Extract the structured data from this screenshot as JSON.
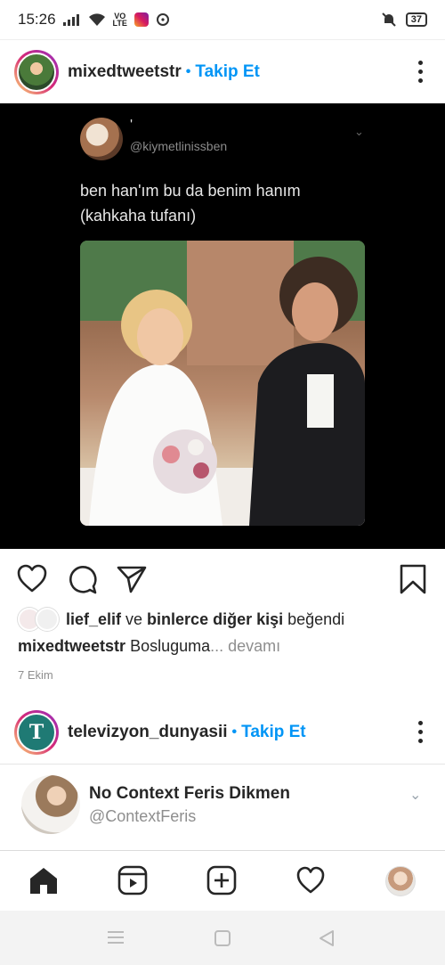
{
  "status_bar": {
    "time": "15:26",
    "network_label": "VO\nLTE",
    "battery": "37"
  },
  "post": {
    "username": "mixedtweetstr",
    "separator": "•",
    "follow_label": "Takip Et",
    "tweet": {
      "display_name": "'",
      "handle": "@kiymetlinissben",
      "text_line1": "ben han'ım bu da benim hanım",
      "text_line2": "(kahkaha tufanı)"
    },
    "likes": {
      "first_liker": "lief_elif",
      "connector": "ve",
      "others": "binlerce diğer kişi",
      "suffix": "beğendi"
    },
    "caption": {
      "username": "mixedtweetstr",
      "text": "Bosluguma",
      "more": "... devamı"
    },
    "date": "7 Ekim"
  },
  "post2": {
    "avatar_letter": "T",
    "username": "televizyon_dunyasii",
    "separator": "•",
    "follow_label": "Takip Et",
    "quote": {
      "display_name": "No Context Feris Dikmen",
      "handle": "@ContextFeris"
    }
  },
  "tabbar": {
    "items": [
      "home",
      "reels",
      "new-post",
      "activity",
      "profile"
    ]
  },
  "colors": {
    "accent": "#0095f6",
    "text": "#262626",
    "muted": "#8e8e8e",
    "media_bg": "#000000"
  }
}
